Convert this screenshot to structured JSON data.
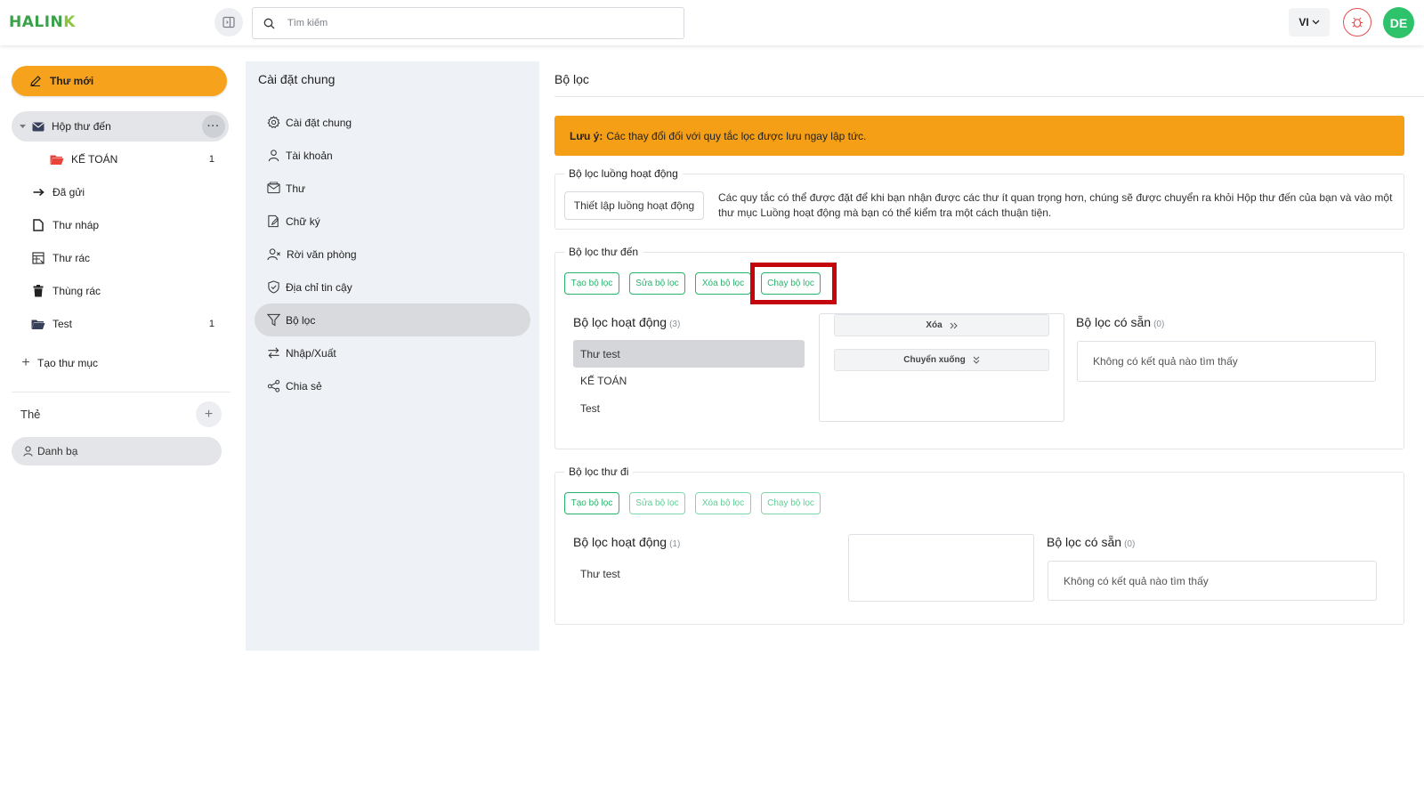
{
  "app": {
    "logo_text_a": "HALIN",
    "logo_text_b": "K",
    "search_placeholder": "Tìm kiếm",
    "language": "VI",
    "avatar_initials": "DE"
  },
  "sidebar": {
    "compose_label": "Thư mới",
    "folders": [
      {
        "label": "Hộp thư đến",
        "count": ""
      },
      {
        "label": "KẾ TOÁN",
        "count": "1"
      },
      {
        "label": "Đã gửi",
        "count": ""
      },
      {
        "label": "Thư nháp",
        "count": ""
      },
      {
        "label": "Thư rác",
        "count": ""
      },
      {
        "label": "Thùng rác",
        "count": ""
      },
      {
        "label": "Test",
        "count": "1"
      }
    ],
    "more_label": "···",
    "create_folder_label": "Tạo thư mục",
    "tags_title": "Thẻ",
    "tags_add": "+",
    "contacts_label": "Danh bạ"
  },
  "settings_nav": {
    "title": "Cài đặt chung",
    "items": [
      {
        "label": "Cài đặt chung",
        "icon": "gear-icon"
      },
      {
        "label": "Tài khoản",
        "icon": "user-icon"
      },
      {
        "label": "Thư",
        "icon": "mail-icon"
      },
      {
        "label": "Chữ ký",
        "icon": "signature-icon"
      },
      {
        "label": "Rời văn phòng",
        "icon": "user-away-icon"
      },
      {
        "label": "Địa chỉ tin cậy",
        "icon": "shield-icon"
      },
      {
        "label": "Bộ lọc",
        "icon": "filter-icon"
      },
      {
        "label": "Nhập/Xuất",
        "icon": "import-export-icon"
      },
      {
        "label": "Chia sẻ",
        "icon": "share-icon"
      }
    ]
  },
  "main": {
    "title": "Bộ lọc",
    "notice_bold": "Lưu ý:",
    "notice_text": "Các thay đổi đối với quy tắc lọc được lưu ngay lập tức.",
    "flow": {
      "legend": "Bộ lọc luồng hoạt động",
      "button": "Thiết lập luồng hoạt động",
      "description": "Các quy tắc có thể được đặt để khi bạn nhận được các thư ít quan trọng hơn, chúng sẽ được chuyển ra khỏi Hộp thư đến của bạn và vào một thư mục Luồng hoạt động mà bạn có thể kiểm tra một cách thuận tiện."
    },
    "incoming": {
      "legend": "Bộ lọc thư đến",
      "buttons": [
        "Tạo bộ lọc",
        "Sửa bộ lọc",
        "Xóa bộ lọc",
        "Chạy bộ lọc"
      ],
      "active_title": "Bộ lọc hoạt động",
      "active_count": "(3)",
      "active_items": [
        "Thư test",
        "KẾ TOÁN",
        "Test"
      ],
      "remove_label": "Xóa",
      "move_down_label": "Chuyển xuống",
      "available_title": "Bộ lọc có sẵn",
      "available_count": "(0)",
      "available_empty": "Không có kết quả nào tìm thấy"
    },
    "outgoing": {
      "legend": "Bộ lọc thư đi",
      "buttons": [
        "Tạo bộ lọc",
        "Sửa bộ lọc",
        "Xóa bộ lọc",
        "Chạy bộ lọc"
      ],
      "active_title": "Bộ lọc hoạt động",
      "active_count": "(1)",
      "active_items": [
        "Thư test"
      ],
      "available_title": "Bộ lọc có sẵn",
      "available_count": "(0)",
      "available_empty": "Không có kết quả nào tìm thấy"
    }
  },
  "colors": {
    "accent_orange": "#f6a21c",
    "green": "#27b36a",
    "highlight_red": "#c4050c"
  }
}
